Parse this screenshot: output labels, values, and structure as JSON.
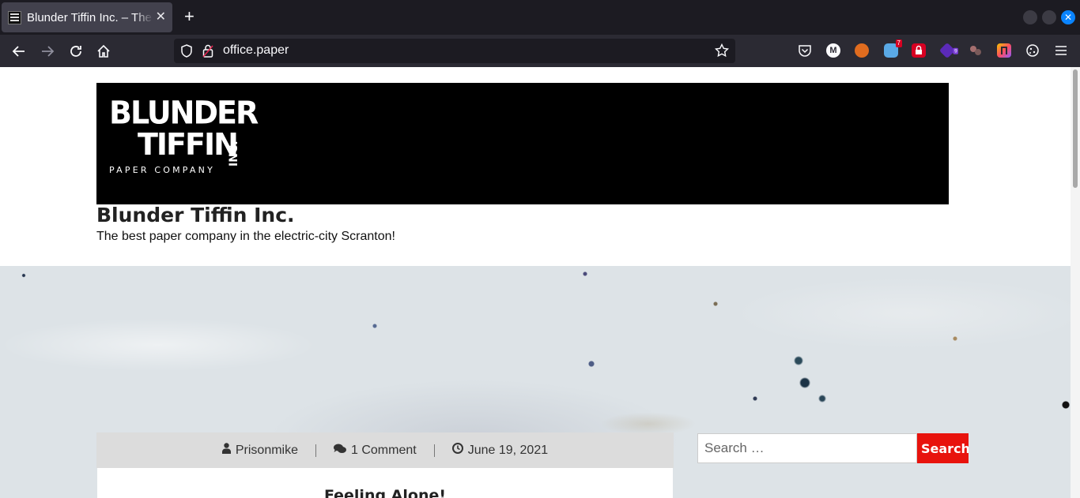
{
  "browser": {
    "tab_title": "Blunder Tiffin Inc. – The best paper company in the electric-city Scranton!",
    "tab_close": "✕",
    "new_tab": "+",
    "url": "office.paper",
    "extension_badges": {
      "red_badge": "7",
      "purple_badge": "9"
    },
    "icons": [
      "back-icon",
      "forward-icon",
      "reload-icon",
      "home-icon",
      "shield-icon",
      "lock-icon",
      "star-icon",
      "pocket-icon",
      "menu-icon"
    ],
    "accent_color": "#0a84ff"
  },
  "site": {
    "logo": {
      "line1": "BLUNDER",
      "line2": "TIFFIN",
      "inc": "INC.",
      "subtitle": "PAPER COMPANY"
    },
    "title": "Blunder Tiffin Inc.",
    "tagline": "The best paper company in the electric-city Scranton!"
  },
  "post": {
    "author": "Prisonmike",
    "comments": "1 Comment",
    "date": "June 19, 2021",
    "title": "Feeling Alone!"
  },
  "search": {
    "placeholder": "Search …",
    "button_label": "Search",
    "button_color": "#e8130d"
  }
}
